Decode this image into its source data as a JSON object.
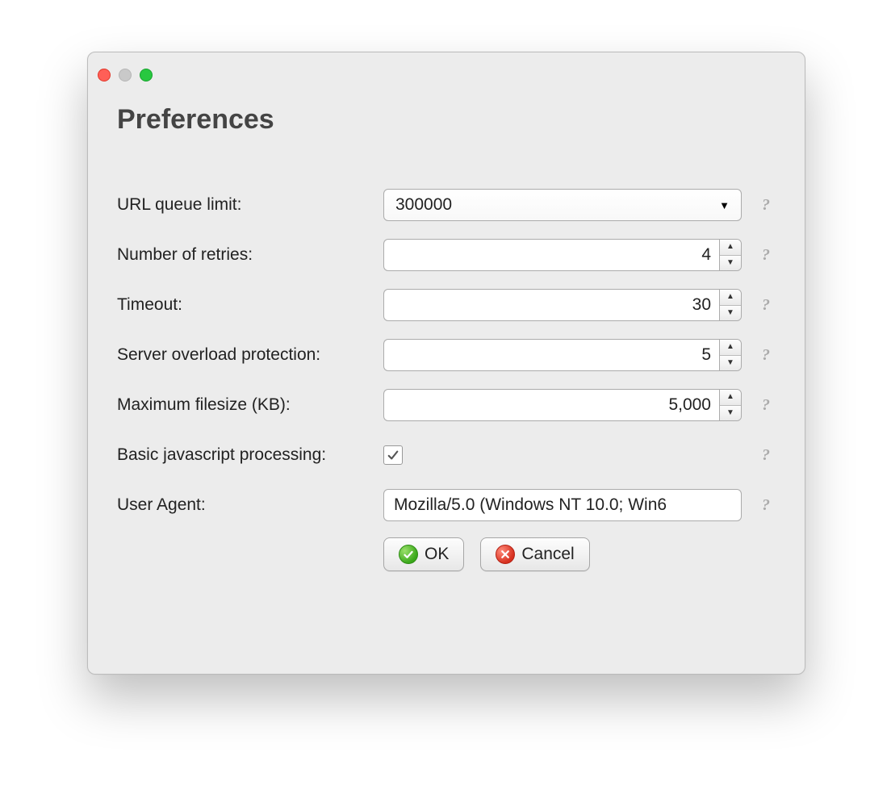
{
  "title": "Preferences",
  "fields": {
    "url_queue_limit": {
      "label": "URL queue limit:",
      "value": "300000"
    },
    "retries": {
      "label": "Number of retries:",
      "value": "4"
    },
    "timeout": {
      "label": "Timeout:",
      "value": "30"
    },
    "overload": {
      "label": "Server overload protection:",
      "value": "5"
    },
    "max_filesize": {
      "label": "Maximum filesize (KB):",
      "value": "5,000"
    },
    "js_processing": {
      "label": "Basic javascript processing:",
      "checked": true
    },
    "user_agent": {
      "label": "User Agent:",
      "value": "Mozilla/5.0 (Windows NT 10.0; Win6"
    }
  },
  "buttons": {
    "ok": "OK",
    "cancel": "Cancel"
  },
  "help_glyph": "?"
}
